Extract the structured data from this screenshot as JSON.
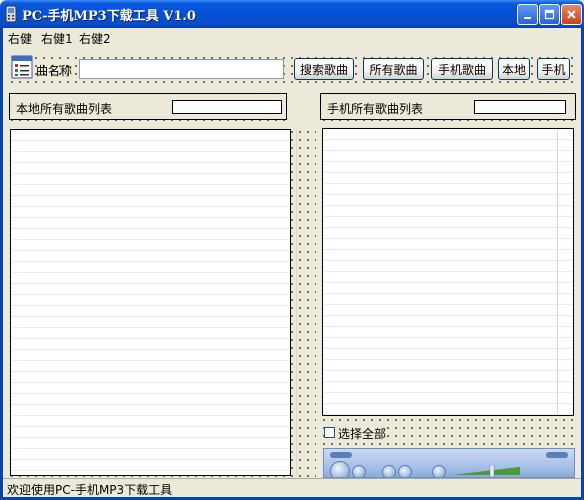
{
  "window": {
    "title": "PC-手机MP3下载工具 V1.0",
    "controls": {
      "minimize": "minimize-icon",
      "maximize": "maximize-icon",
      "close": "close-icon"
    }
  },
  "menu": [
    "右健",
    "右健1",
    "右健2"
  ],
  "search": {
    "label": "曲名称",
    "value": "",
    "buttons": {
      "search": "搜索歌曲",
      "all": "所有歌曲",
      "phone_songs": "手机歌曲",
      "local": "本地",
      "phone": "手机"
    }
  },
  "panels": {
    "local": {
      "title": "本地所有歌曲列表",
      "field_value": ""
    },
    "phone": {
      "title": "手机所有歌曲列表",
      "field_value": ""
    }
  },
  "select_all": {
    "label": "选择全部",
    "checked": false
  },
  "status": {
    "text": "欢迎使用PC-手机MP3下载工具"
  }
}
